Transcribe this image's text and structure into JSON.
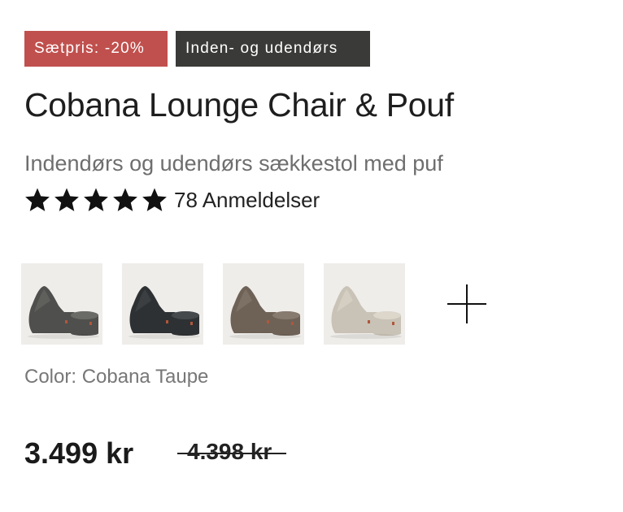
{
  "badges": {
    "sale": "Sætpris: -20%",
    "category": "Inden- og udendørs"
  },
  "product": {
    "title": "Cobana Lounge Chair & Pouf",
    "subtitle": "Indendørs og udendørs sækkestol med puf",
    "rating": 5,
    "rating_max": 5,
    "reviews": "78 Anmeldelser"
  },
  "swatches": [
    {
      "name": "swatch-grey",
      "chair_color": "#4f4f4d",
      "highlight": "#6a6a67"
    },
    {
      "name": "swatch-black",
      "chair_color": "#2e3133",
      "highlight": "#45494c"
    },
    {
      "name": "swatch-taupe",
      "chair_color": "#6e6257",
      "highlight": "#877a6e"
    },
    {
      "name": "swatch-sand",
      "chair_color": "#c9c2b6",
      "highlight": "#dcd6cb"
    }
  ],
  "color": {
    "label": "Color: Cobana Taupe"
  },
  "pricing": {
    "price": "3.499 kr",
    "old_price": "4.398 kr"
  }
}
